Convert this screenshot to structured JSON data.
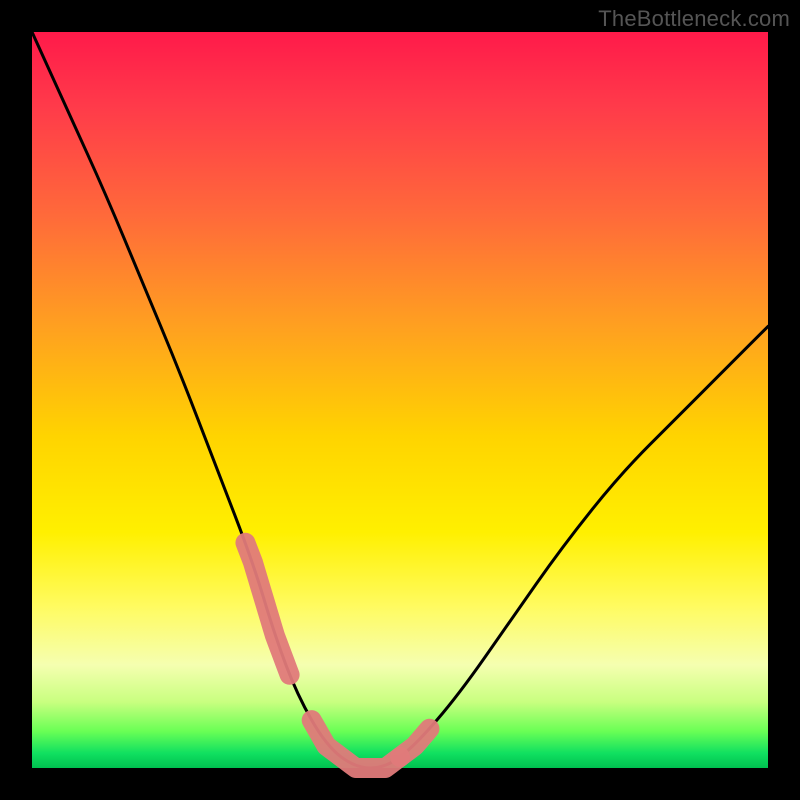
{
  "watermark": "TheBottleneck.com",
  "chart_data": {
    "type": "line",
    "title": "",
    "xlabel": "",
    "ylabel": "",
    "xlim": [
      0,
      100
    ],
    "ylim": [
      0,
      100
    ],
    "series": [
      {
        "name": "bottleneck-curve",
        "x": [
          0,
          5,
          10,
          15,
          20,
          25,
          30,
          33,
          36,
          40,
          44,
          48,
          52,
          58,
          65,
          72,
          80,
          88,
          94,
          100
        ],
        "y": [
          100,
          89,
          78,
          66,
          54,
          41,
          28,
          18,
          10,
          3,
          0,
          0,
          3,
          10,
          20,
          30,
          40,
          48,
          54,
          60
        ]
      }
    ],
    "highlight_zones": [
      {
        "name": "left-slope-marker",
        "x_range": [
          29,
          35
        ],
        "color": "#e07a7a"
      },
      {
        "name": "valley-floor-marker",
        "x_range": [
          38,
          50
        ],
        "color": "#e07a7a"
      },
      {
        "name": "right-slope-marker",
        "x_range": [
          50,
          54
        ],
        "color": "#e07a7a"
      }
    ]
  }
}
